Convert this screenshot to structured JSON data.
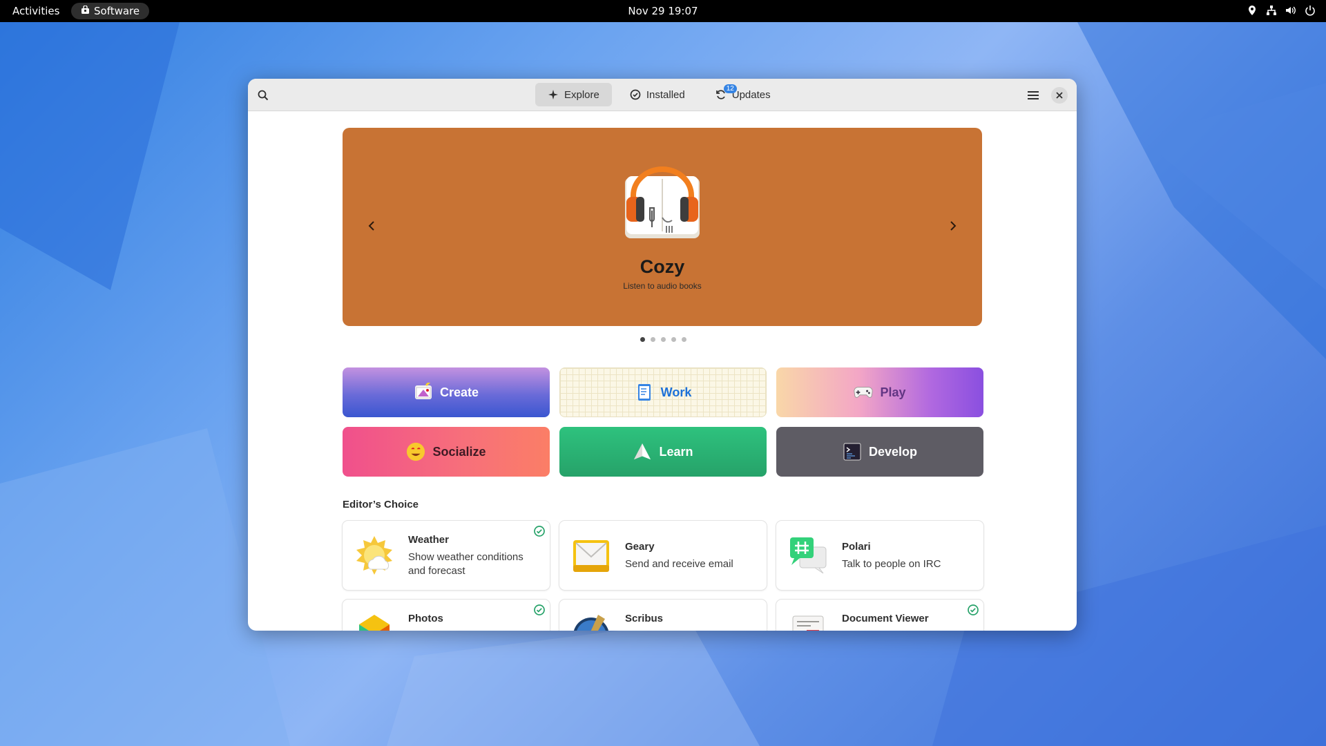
{
  "topbar": {
    "activities": "Activities",
    "app_name": "Software",
    "clock": "Nov 29  19:07"
  },
  "window": {
    "tabs": [
      {
        "label": "Explore",
        "icon": "sparkle-icon",
        "active": true
      },
      {
        "label": "Installed",
        "icon": "check-circle-icon",
        "active": false
      },
      {
        "label": "Updates",
        "icon": "refresh-icon",
        "active": false,
        "badge": "12"
      }
    ]
  },
  "banner": {
    "title": "Cozy",
    "subtitle": "Listen to audio books",
    "background": "#c87334",
    "pages": 5,
    "current_page": 1
  },
  "categories": [
    {
      "label": "Create",
      "icon": "create-icon",
      "text_color": "#ffffff"
    },
    {
      "label": "Work",
      "icon": "work-icon",
      "text_color": "#1c71d8"
    },
    {
      "label": "Play",
      "icon": "gamepad-icon",
      "text_color": "#613583"
    },
    {
      "label": "Socialize",
      "icon": "smiley-icon",
      "text_color": "#3d1a24"
    },
    {
      "label": "Learn",
      "icon": "learn-icon",
      "text_color": "#ffffff"
    },
    {
      "label": "Develop",
      "icon": "terminal-icon",
      "text_color": "#ffffff"
    }
  ],
  "editors_choice": {
    "title": "Editor’s Choice",
    "apps": [
      {
        "name": "Weather",
        "description": "Show weather conditions and forecast",
        "installed": true,
        "icon": "weather-icon"
      },
      {
        "name": "Geary",
        "description": "Send and receive email",
        "installed": false,
        "icon": "mail-icon"
      },
      {
        "name": "Polari",
        "description": "Talk to people on IRC",
        "installed": false,
        "icon": "chat-icon"
      },
      {
        "name": "Photos",
        "description": "",
        "installed": true,
        "icon": "photos-icon"
      },
      {
        "name": "Scribus",
        "description": "",
        "installed": false,
        "icon": "scribus-icon"
      },
      {
        "name": "Document Viewer",
        "description": "",
        "installed": true,
        "icon": "document-icon"
      }
    ]
  }
}
